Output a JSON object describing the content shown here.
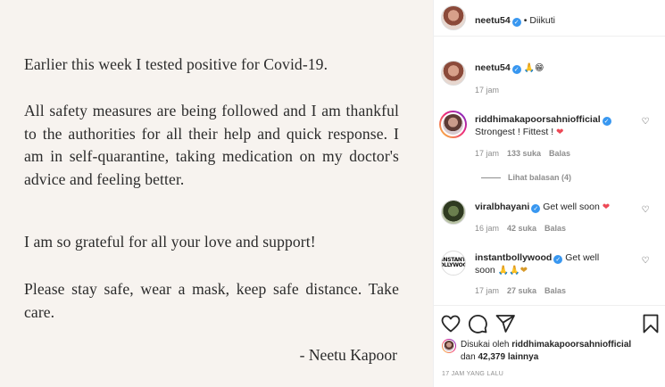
{
  "post": {
    "paragraph_1": "Earlier this week I tested positive for Covid-19.",
    "paragraph_2": "All safety measures are being followed and I am thankful to the authorities for all their help and quick response. I am in self-quarantine, taking medication on my doctor's advice and feeling better.",
    "paragraph_3": "I am so grateful for all your love and support!",
    "paragraph_4": "Please stay safe, wear a mask, keep safe distance. Take care.",
    "signature": "- Neetu Kapoor"
  },
  "header": {
    "username": "neetu54",
    "separator": "•",
    "follow_label": "Diikuti"
  },
  "caption": {
    "username": "neetu54",
    "emoji": "🙏😁",
    "time": "17 jam"
  },
  "comments": [
    {
      "username": "riddhimakapoorsahniofficial",
      "text": "Strongest ! Fittest !",
      "emoji": "❤",
      "time": "17 jam",
      "likes": "133 suka",
      "reply": "Balas",
      "view_replies": "Lihat balasan (4)"
    },
    {
      "username": "viralbhayani",
      "text": "Get well soon",
      "emoji": "❤",
      "time": "16 jam",
      "likes": "42 suka",
      "reply": "Balas"
    },
    {
      "username": "instantbollywood",
      "text_1": "Get well",
      "text_2": "soon",
      "emoji": "🙏🙏❤",
      "time": "17 jam",
      "likes": "27 suka",
      "reply": "Balas",
      "avatar_text": "INSTANT BOLLYWOOD"
    }
  ],
  "actions": {
    "liked_by_prefix": "Disukai oleh",
    "liked_by_user": "riddhimakapoorsahniofficial",
    "and_label": "dan",
    "others_count": "42,379 lainnya",
    "time_ago": "17 JAM YANG LALU"
  },
  "icons": {
    "like": "heart-outline-icon",
    "comment": "comment-icon",
    "share": "paper-plane-icon",
    "save": "bookmark-icon",
    "verified": "verified-badge-icon"
  },
  "colors": {
    "verified": "#3897f0",
    "heart_red": "#ed4956",
    "muted_text": "#8e8e8e",
    "post_background": "#f7f3ef"
  }
}
